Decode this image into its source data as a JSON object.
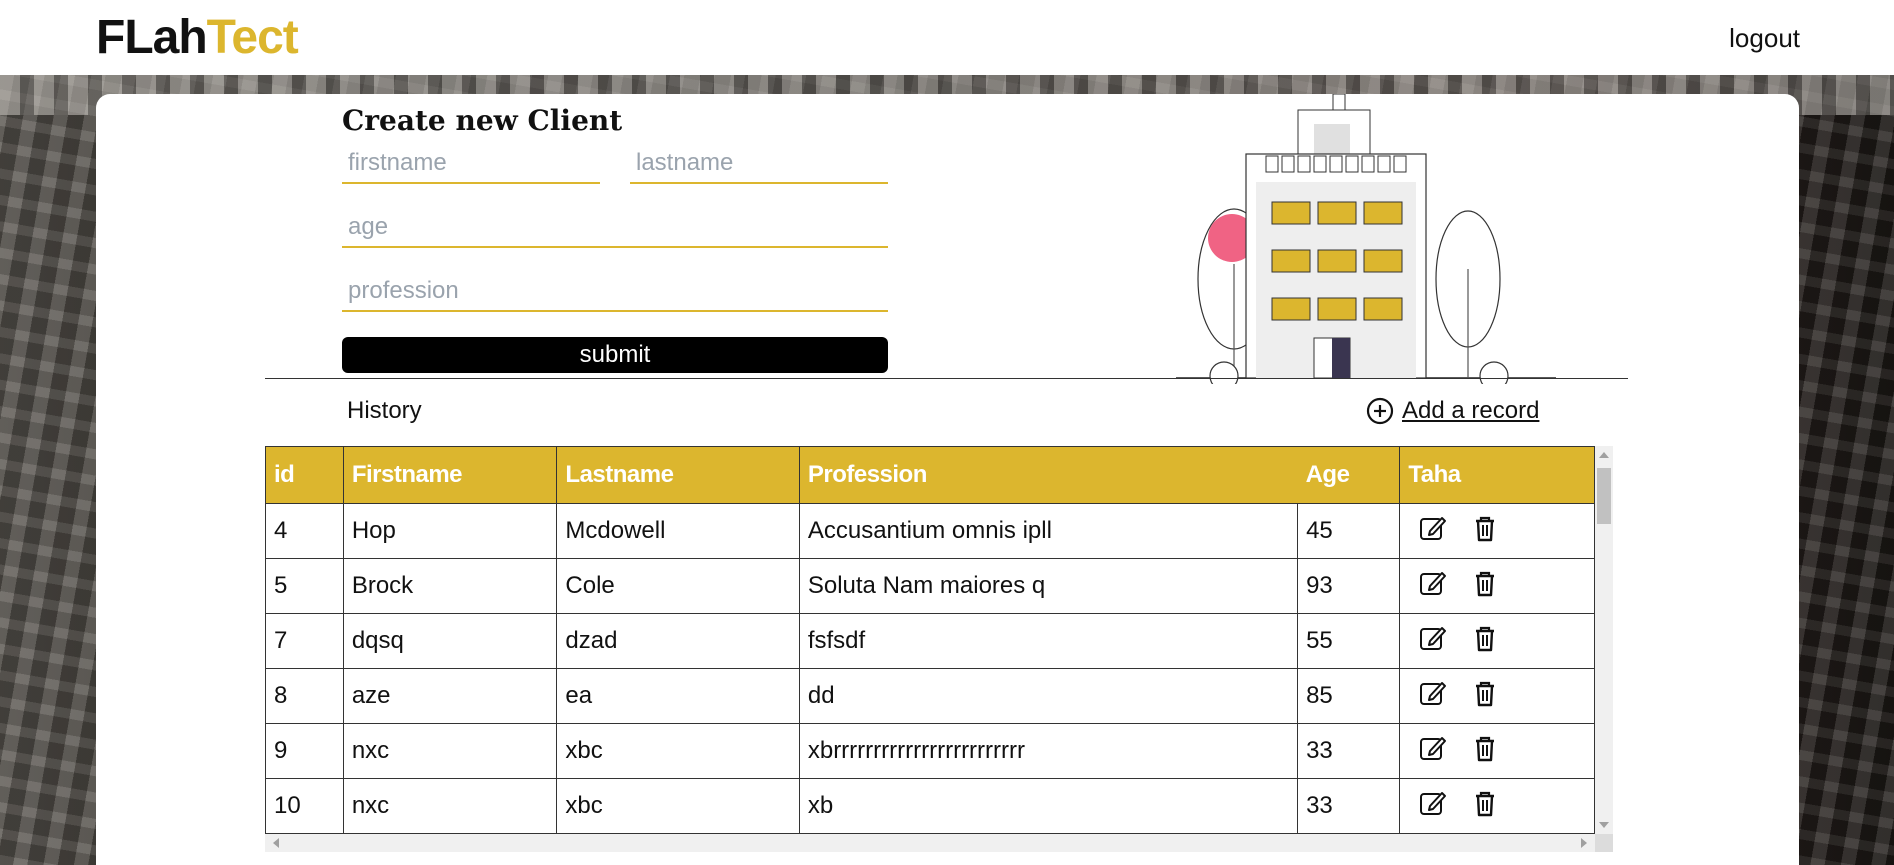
{
  "header": {
    "logo_part1": "FLah",
    "logo_part2": "Tect",
    "logout_label": "logout"
  },
  "form": {
    "title": "Create new Client",
    "firstname_placeholder": "firstname",
    "lastname_placeholder": "lastname",
    "age_placeholder": "age",
    "profession_placeholder": "profession",
    "submit_label": "submit"
  },
  "history": {
    "title": "History",
    "add_record_label": "Add a record"
  },
  "table": {
    "columns": [
      "id",
      "Firstname",
      "Lastname",
      "Profession",
      "Age",
      "Taha"
    ],
    "rows": [
      {
        "id": "4",
        "firstname": "Hop",
        "lastname": "Mcdowell",
        "profession": "Accusantium omnis ipll",
        "age": "45"
      },
      {
        "id": "5",
        "firstname": "Brock",
        "lastname": "Cole",
        "profession": "Soluta Nam maiores q",
        "age": "93"
      },
      {
        "id": "7",
        "firstname": "dqsq",
        "lastname": "dzad",
        "profession": "fsfsdf",
        "age": "55"
      },
      {
        "id": "8",
        "firstname": "aze",
        "lastname": "ea",
        "profession": "dd",
        "age": "85"
      },
      {
        "id": "9",
        "firstname": "nxc",
        "lastname": "xbc",
        "profession": "xbrrrrrrrrrrrrrrrrrrrrrrrr",
        "age": "33"
      },
      {
        "id": "10",
        "firstname": "nxc",
        "lastname": "xbc",
        "profession": "xb",
        "age": "33"
      }
    ]
  },
  "colors": {
    "accent": "#dcb62e",
    "dark": "#000000",
    "pink": "#f06384"
  },
  "icons": {
    "edit": "edit-icon",
    "delete": "trash-icon",
    "add": "plus-circle-icon"
  }
}
